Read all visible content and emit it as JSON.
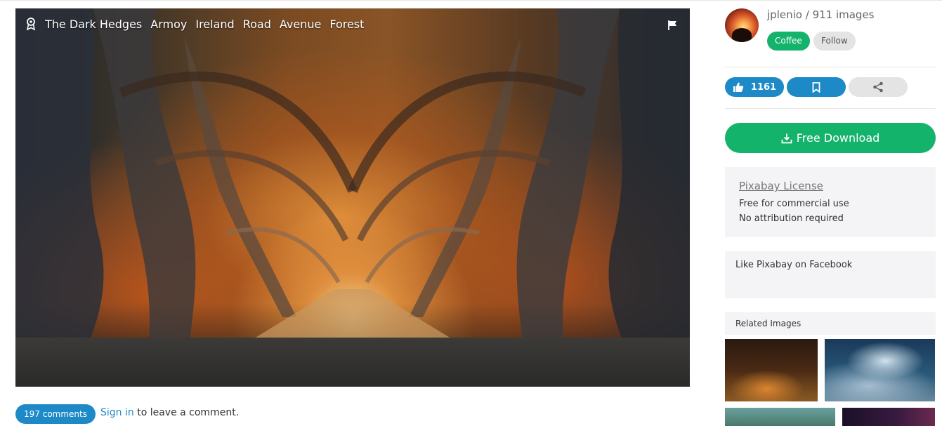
{
  "photo": {
    "alt": "The Dark Hedges tree avenue in autumn",
    "tags": [
      "The Dark Hedges",
      "Armoy",
      "Ireland",
      "Road",
      "Avenue",
      "Forest"
    ],
    "award_icon": "award-icon",
    "flag_icon": "flag-icon"
  },
  "comments": {
    "badge": "197 comments",
    "signin_link": "Sign in",
    "signin_suffix": "to leave a comment."
  },
  "user": {
    "name": "jplenio",
    "separator": "/",
    "images": "911 images",
    "coffee_label": "Coffee",
    "follow_label": "Follow"
  },
  "actions": {
    "like_count": "1161",
    "like_icon": "thumbs-up-icon",
    "bookmark_icon": "bookmark-icon",
    "share_icon": "share-icon"
  },
  "download": {
    "label": "Free Download",
    "icon": "download-icon"
  },
  "license": {
    "title": "Pixabay License",
    "line1": "Free for commercial use",
    "line2": "No attribution required"
  },
  "facebook": {
    "text": "Like Pixabay on Facebook"
  },
  "related": {
    "title": "Related Images"
  },
  "colors": {
    "primary_blue": "#1d8ac7",
    "green": "#14b36b",
    "light_gray": "#e4e4e4",
    "panel_bg": "#f4f4f7"
  }
}
